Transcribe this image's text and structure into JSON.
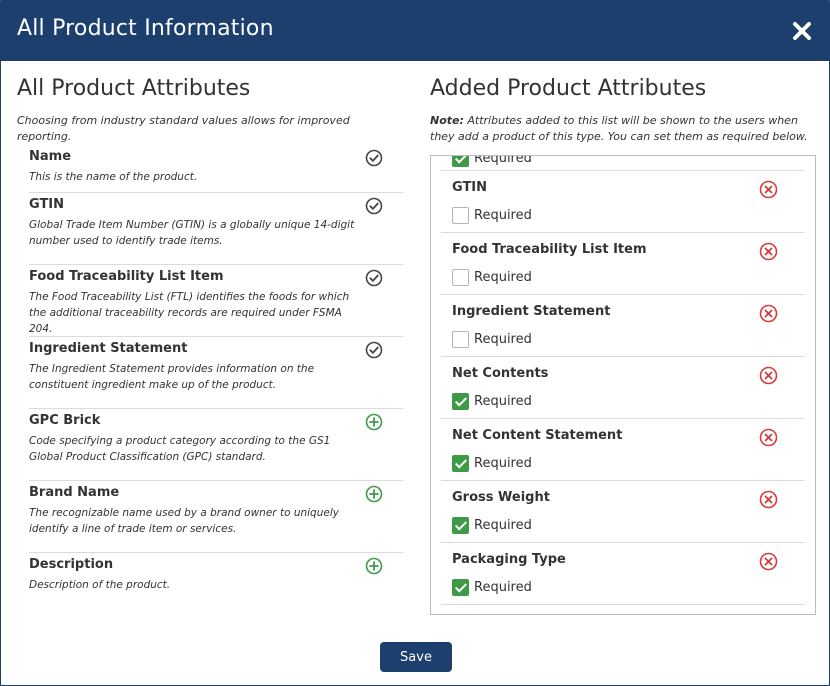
{
  "modal": {
    "title": "All Product Information",
    "save_label": "Save"
  },
  "left": {
    "title": "All Product Attributes",
    "subtitle": "Choosing from industry standard values allows for improved reporting.",
    "items": [
      {
        "name": "Name",
        "desc": "This is the name of the product.",
        "icon": "check-circle-icon",
        "state": "added"
      },
      {
        "name": "GTIN",
        "desc": "Global Trade Item Number (GTIN) is a globally unique 14-digit number used to identify trade items.",
        "icon": "check-circle-icon",
        "state": "added"
      },
      {
        "name": "Food Traceability List Item",
        "desc": "The Food Traceability List (FTL) identifies the foods for which the additional traceability records are required under FSMA 204.",
        "icon": "check-circle-icon",
        "state": "added"
      },
      {
        "name": "Ingredient Statement",
        "desc": "The Ingredient Statement provides information on the constituent ingredient make up of the product.",
        "icon": "check-circle-icon",
        "state": "added"
      },
      {
        "name": "GPC Brick",
        "desc": "Code specifying a product category according to the GS1 Global Product Classification (GPC) standard.",
        "icon": "plus-circle-icon",
        "state": "available"
      },
      {
        "name": "Brand Name",
        "desc": "The recognizable name used by a brand owner to uniquely identify a line of trade item or services.",
        "icon": "plus-circle-icon",
        "state": "available"
      },
      {
        "name": "Description",
        "desc": "Description of the product.",
        "icon": "plus-circle-icon",
        "state": "available"
      }
    ]
  },
  "right": {
    "title": "Added Product Attributes",
    "note_label": "Note:",
    "note_text": " Attributes added to this list will be shown to the users when they add a product of this type. You can set them as required below.",
    "partial_item": {
      "required_label": "Required",
      "required": true
    },
    "items": [
      {
        "name": "GTIN",
        "required_label": "Required",
        "required": false
      },
      {
        "name": "Food Traceability List Item",
        "required_label": "Required",
        "required": false
      },
      {
        "name": "Ingredient Statement",
        "required_label": "Required",
        "required": false
      },
      {
        "name": "Net Contents",
        "required_label": "Required",
        "required": true
      },
      {
        "name": "Net Content Statement",
        "required_label": "Required",
        "required": true
      },
      {
        "name": "Gross Weight",
        "required_label": "Required",
        "required": true
      },
      {
        "name": "Packaging Type",
        "required_label": "Required",
        "required": true
      }
    ]
  },
  "colors": {
    "header_bg": "#1c3f6e",
    "check_icon": "#444444",
    "plus_icon": "#3f9a47",
    "remove_icon": "#d63b3b",
    "checkbox_checked": "#3f9a47"
  }
}
